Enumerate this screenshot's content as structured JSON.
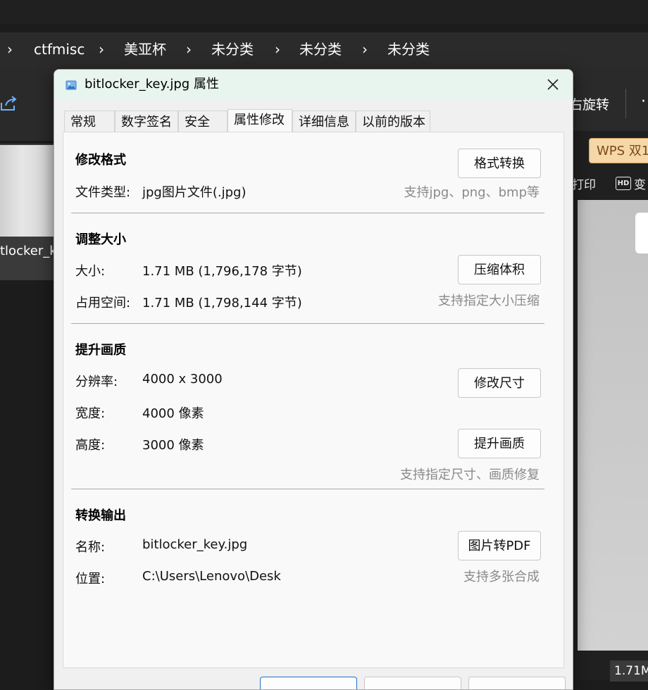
{
  "explorer": {
    "breadcrumb": [
      "ctfmisc",
      "美亚杯",
      "未分类",
      "未分类",
      "未分类"
    ],
    "toolbar_rotate_label": "右旋转",
    "thumbnail_label": "tlocker_ke g",
    "wps_label": "WPS 双1",
    "print_label": "打印",
    "hd_icon": "HD",
    "hd_label": "变",
    "size_badge": "1.71M"
  },
  "dialog": {
    "title": "bitlocker_key.jpg 属性",
    "tabs": [
      "常规",
      "数字签名",
      "安全",
      "属性修改",
      "详细信息",
      "以前的版本"
    ],
    "active_tab": "属性修改",
    "sections": {
      "format": {
        "title": "修改格式",
        "type_label": "文件类型:",
        "type_value": "jpg图片文件(.jpg)",
        "button": "格式转换",
        "hint": "支持jpg、png、bmp等"
      },
      "resize": {
        "title": "调整大小",
        "size_label": "大小:",
        "size_value": "1.71 MB (1,796,178 字节)",
        "disk_label": "占用空间:",
        "disk_value": "1.71 MB (1,798,144 字节)",
        "button": "压缩体积",
        "hint": "支持指定大小压缩"
      },
      "quality": {
        "title": "提升画质",
        "resolution_label": "分辨率:",
        "resolution_value": "4000 x 3000",
        "width_label": "宽度:",
        "width_value": "4000 像素",
        "height_label": "高度:",
        "height_value": "3000 像素",
        "resize_button": "修改尺寸",
        "enhance_button": "提升画质",
        "hint": "支持指定尺寸、画质修复"
      },
      "convert": {
        "title": "转换输出",
        "name_label": "名称:",
        "name_value": "bitlocker_key.jpg",
        "location_label": "位置:",
        "location_value": "C:\\Users\\Lenovo\\Desk",
        "button": "图片转PDF",
        "hint": "支持多张合成"
      }
    }
  },
  "colors": {
    "accent": "#1f6fc5",
    "titlebar": "#e8f5ee",
    "hint": "#8a8a8a",
    "wps": "#f5d7a8"
  }
}
